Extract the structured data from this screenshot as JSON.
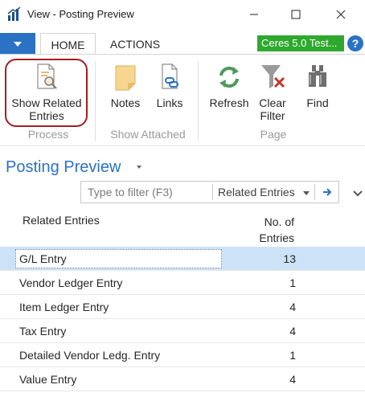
{
  "window": {
    "title": "View - Posting Preview"
  },
  "tabs": {
    "home": "HOME",
    "actions": "ACTIONS",
    "company": "Ceres 5.0 Test..."
  },
  "ribbon": {
    "process_group": "Process",
    "show_related": "Show Related Entries",
    "show_attached_group": "Show Attached",
    "notes": "Notes",
    "links": "Links",
    "page_group": "Page",
    "refresh": "Refresh",
    "clear_filter": "Clear Filter",
    "find": "Find"
  },
  "page": {
    "title": "Posting Preview"
  },
  "filter": {
    "placeholder": "Type to filter (F3)",
    "field": "Related Entries"
  },
  "table": {
    "col_name": "Related Entries",
    "col_count": "No. of Entries",
    "rows": [
      {
        "name": "G/L Entry",
        "count": "13"
      },
      {
        "name": "Vendor Ledger Entry",
        "count": "1"
      },
      {
        "name": "Item Ledger Entry",
        "count": "4"
      },
      {
        "name": "Tax Entry",
        "count": "4"
      },
      {
        "name": "Detailed Vendor Ledg. Entry",
        "count": "1"
      },
      {
        "name": "Value Entry",
        "count": "4"
      }
    ],
    "selected_row": 0
  },
  "colors": {
    "accent": "#2b72c4",
    "company_badge": "#2ea82e",
    "highlight_ring": "#a31f24",
    "selected_row": "#cce3f7"
  },
  "icons": {
    "app": "dynamics-nav-icon",
    "show_related": "document-search-icon",
    "notes": "note-icon",
    "links": "link-document-icon",
    "refresh": "refresh-icon",
    "clear_filter": "clear-filter-icon",
    "find": "binoculars-icon",
    "help": "help-icon"
  }
}
